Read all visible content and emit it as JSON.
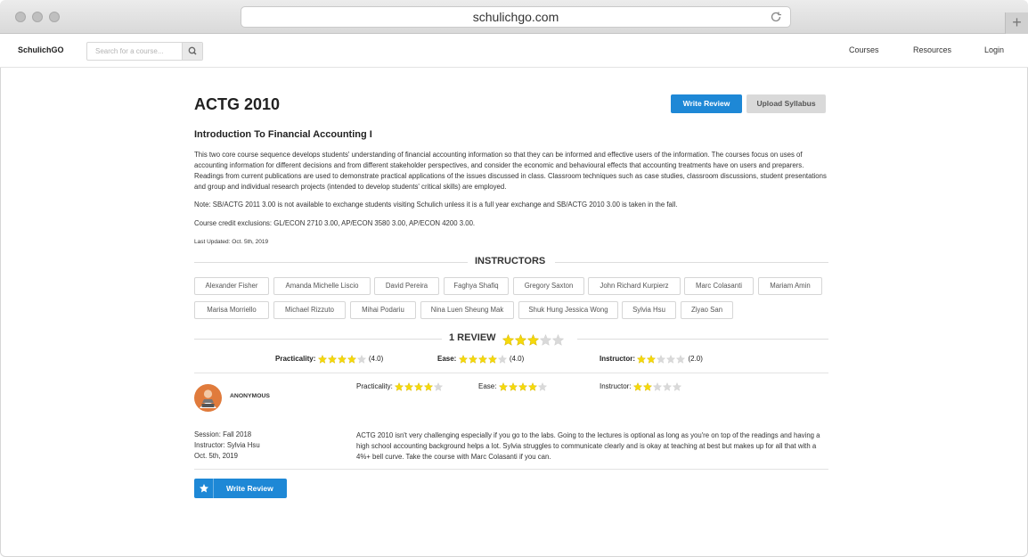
{
  "browser": {
    "url": "schulichgo.com"
  },
  "nav": {
    "brand": "SchulichGO",
    "search_placeholder": "Search for a course...",
    "links": [
      "Courses",
      "Resources",
      "Login"
    ]
  },
  "course": {
    "code": "ACTG 2010",
    "title": "Introduction To Financial Accounting I",
    "description": "This two core course sequence develops students' understanding of financial accounting information so that they can be informed and effective users of the information. The courses focus on uses of accounting information for different decisions and from different stakeholder perspectives, and consider the economic and behavioural effects that accounting treatments have on users and preparers. Readings from current publications are used to demonstrate practical applications of the issues discussed in class. Classroom techniques such as case studies, classroom discussions, student presentations and group and individual research projects (intended to develop students' critical skills) are employed.",
    "note": "Note: SB/ACTG 2011 3.00 is not available to exchange students visiting Schulich unless it is a full year exchange and SB/ACTG 2010 3.00 is taken in the fall.",
    "exclusions": "Course credit exclusions: GL/ECON 2710 3.00, AP/ECON 3580 3.00, AP/ECON 4200 3.00.",
    "last_updated": "Last Updated: Oct. 5th, 2019"
  },
  "buttons": {
    "write_review": "Write Review",
    "upload_syllabus": "Upload Syllabus"
  },
  "instructors": {
    "heading": "INSTRUCTORS",
    "names": [
      "Alexander Fisher",
      "Amanda Michelle Liscio",
      "David Pereira",
      "Faghya Shafiq",
      "Gregory Saxton",
      "John Richard Kurpierz",
      "Marc Colasanti",
      "Mariam Amin",
      "Marisa Morriello",
      "Michael Rizzuto",
      "Mihai Podariu",
      "Nina Luen Sheung Mak",
      "Shuk Hung Jessica Wong",
      "Sylvia Hsu",
      "Ziyao San"
    ]
  },
  "reviews_summary": {
    "heading": "1 REVIEW",
    "overall_stars": 3,
    "practicality_label": "Practicality:",
    "practicality_stars": 4,
    "practicality_value": "(4.0)",
    "ease_label": "Ease:",
    "ease_stars": 4,
    "ease_value": "(4.0)",
    "instructor_label": "Instructor:",
    "instructor_stars": 2,
    "instructor_value": "(2.0)"
  },
  "review": {
    "author": "ANONYMOUS",
    "practicality_label": "Practicality:",
    "practicality_stars": 4,
    "ease_label": "Ease:",
    "ease_stars": 4,
    "instructor_label": "Instructor:",
    "instructor_stars": 2,
    "session": "Session: Fall 2018",
    "instructor": "Instructor: Sylvia Hsu",
    "date": "Oct. 5th, 2019",
    "text": "ACTG 2010 isn't very challenging especially if you go to the labs. Going to the lectures is optional as long as you're on top of the readings and having a high school accounting background helps a lot. Sylvia struggles to communicate clearly and is okay at teaching at best but makes up for all that with a 4%+ bell curve. Take the course with Marc Colasanti if you can."
  },
  "colors": {
    "accent": "#1e88d6",
    "star_on": "#f5d90a",
    "star_off": "#d9d9d9",
    "avatar": "#e07b3c"
  }
}
